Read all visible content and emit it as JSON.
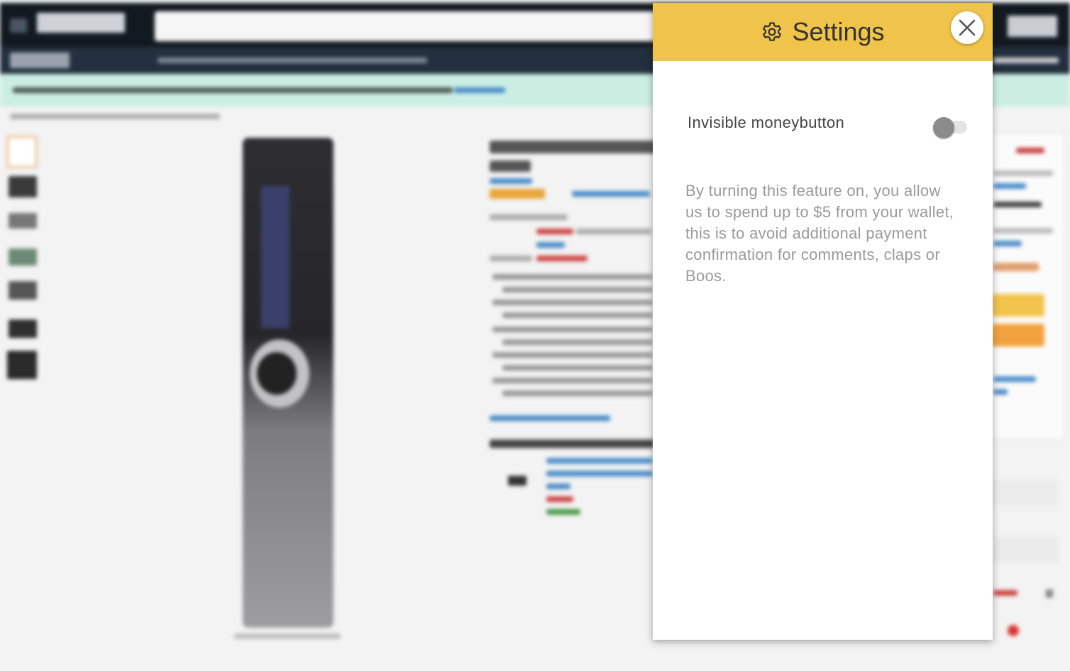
{
  "settings_panel": {
    "title": "Settings",
    "header_icon": "gear-icon",
    "close_icon": "close-icon",
    "header_color": "#f0c44b",
    "options": [
      {
        "label": "Invisible moneybutton",
        "enabled": false,
        "description": "By turning this feature on, you allow us to spend up to $5 from your wallet, this is to avoid additional payment confirmation for comments, claps or Boos."
      }
    ]
  },
  "background": {
    "note_state": "blurred",
    "site_colors": {
      "header": "#131921",
      "nav": "#232f3e",
      "banner": "#cbeee3"
    }
  }
}
